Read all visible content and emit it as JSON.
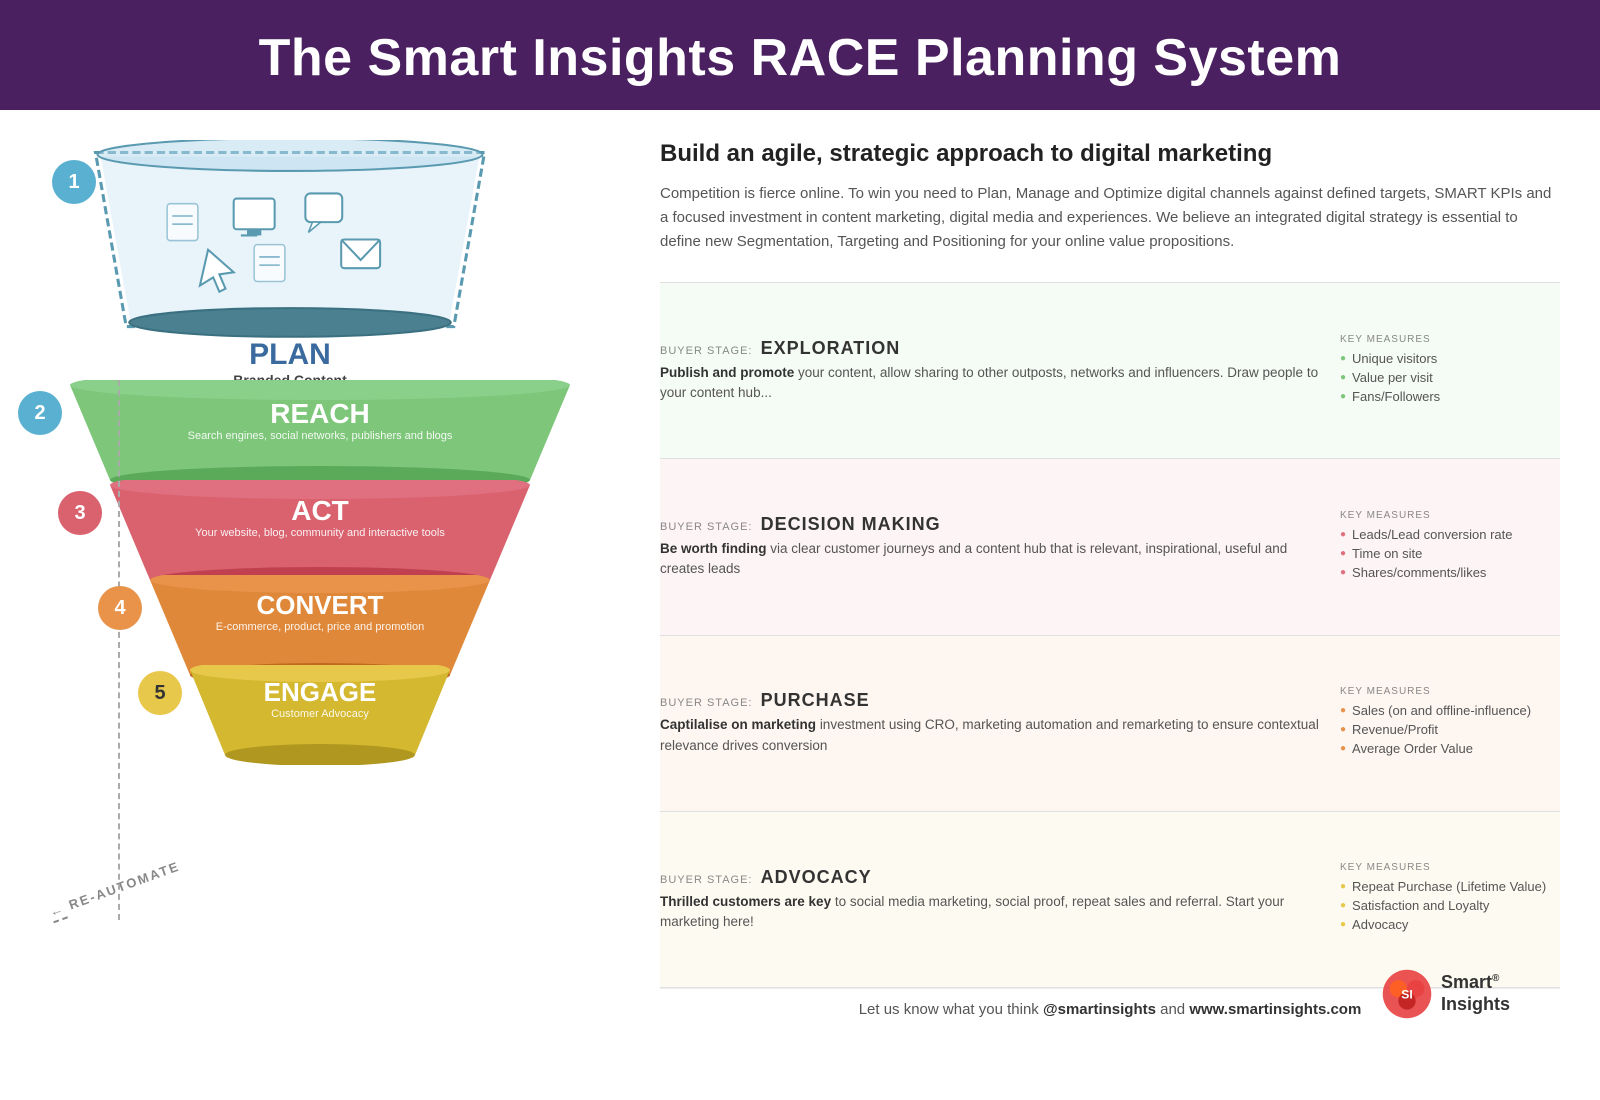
{
  "header": {
    "title": "The Smart Insights RACE Planning System"
  },
  "intro": {
    "heading": "Build an agile, strategic approach to digital marketing",
    "body": "Competition is fierce online. To win you need to Plan, Manage and Optimize digital channels against defined targets, SMART KPIs and a focused investment in content marketing, digital media and experiences. We believe an integrated digital strategy is essential to define new Segmentation, Targeting and Positioning for your online value propositions."
  },
  "funnel": {
    "plan": {
      "number": "1",
      "main_label": "PLAN",
      "sub_label": "Branded Content"
    },
    "reach": {
      "number": "2",
      "main_label": "REACH",
      "sub_label": "Search engines, social networks, publishers and blogs",
      "color": "#7dc67a"
    },
    "act": {
      "number": "3",
      "main_label": "ACT",
      "sub_label": "Your website, blog, community and interactive tools",
      "color": "#e07080"
    },
    "convert": {
      "number": "4",
      "main_label": "CONVERT",
      "sub_label": "E-commerce, product, price and promotion",
      "color": "#e8924a"
    },
    "engage": {
      "number": "5",
      "main_label": "ENGAGE",
      "sub_label": "Customer Advocacy",
      "color": "#e8c84a"
    },
    "re_automate": "RE-AUTOMATE"
  },
  "rows": [
    {
      "id": "reach",
      "buyer_stage_label": "BUYER STAGE:",
      "buyer_stage_name": "EXPLORATION",
      "description_bold": "Publish and promote",
      "description_rest": " your content, allow sharing to other outposts, networks and influencers. Draw people to your content hub...",
      "key_measures_label": "KEY MEASURES",
      "measures": [
        "Unique visitors",
        "Value per visit",
        "Fans/Followers"
      ]
    },
    {
      "id": "act",
      "buyer_stage_label": "BUYER STAGE:",
      "buyer_stage_name": "DECISION MAKING",
      "description_bold": "Be worth finding",
      "description_rest": " via clear customer journeys and a content hub that is relevant, inspirational, useful and creates leads",
      "key_measures_label": "KEY MEASURES",
      "measures": [
        "Leads/Lead conversion rate",
        "Time on site",
        "Shares/comments/likes"
      ]
    },
    {
      "id": "convert",
      "buyer_stage_label": "BUYER STAGE:",
      "buyer_stage_name": "PURCHASE",
      "description_bold": "Captilalise on marketing",
      "description_rest": " investment using CRO, marketing automation and remarketing to ensure contextual relevance drives conversion",
      "key_measures_label": "KEY MEASURES",
      "measures": [
        "Sales (on and offline-influence)",
        "Revenue/Profit",
        "Average Order Value"
      ]
    },
    {
      "id": "engage",
      "buyer_stage_label": "BUYER STAGE:",
      "buyer_stage_name": "ADVOCACY",
      "description_bold": "Thrilled customers are key",
      "description_rest": " to social media marketing, social proof, repeat sales and referral. Start your marketing here!",
      "key_measures_label": "KEY MEASURES",
      "measures": [
        "Repeat Purchase (Lifetime Value)",
        "Satisfaction and Loyalty",
        "Advocacy"
      ]
    }
  ],
  "footer": {
    "text_before": "Let us know what you think ",
    "handle": "@smartinsights",
    "text_mid": " and ",
    "website": "www.smartinsights.com"
  },
  "logo": {
    "name": "Smart® Insights"
  }
}
